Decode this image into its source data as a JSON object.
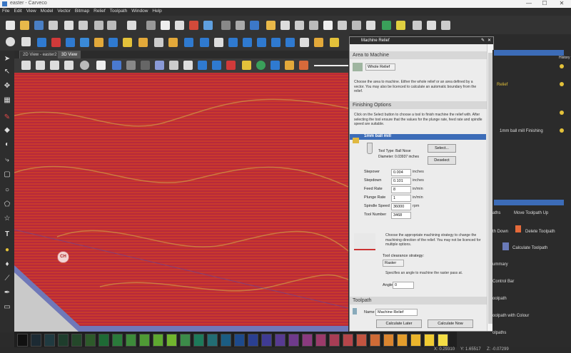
{
  "window": {
    "title": "easter - Carveco",
    "controls": [
      "—",
      "☐",
      "✕"
    ]
  },
  "menu": [
    "File",
    "Edit",
    "View",
    "Model",
    "Vector",
    "Bitmap",
    "Relief",
    "Toolpath",
    "Window",
    "Help"
  ],
  "tabs": [
    {
      "label": "2D View - easter2"
    },
    {
      "label": "3D View"
    }
  ],
  "viewport": {
    "cursor_badge": "CH"
  },
  "dialog": {
    "title": "Machine Relief",
    "area_section": "Area to Machine",
    "area_select": "Whole Relief",
    "area_text": "Choose the area to machine. Either the whole relief or an area defined by a vector. You may also be licenced to calculate an automatic boundary from the relief.",
    "finishing_section": "Finishing Options",
    "finishing_text": "Click on the Select button to choose a tool to finish machine the relief with. After selecting the tool ensure that the values for the plunge rate, feed rate and spindle speed are suitable.",
    "tool_header": "1mm ball mill",
    "tool_type": "Tool Type: Ball Nose",
    "tool_diameter": "Diameter:  0.03937 inches",
    "select_btn": "Select...",
    "deselect_btn": "Deselect",
    "fields": [
      {
        "label": "Stepover",
        "value": "0.004",
        "unit": "inches"
      },
      {
        "label": "Stepdown",
        "value": "0.101",
        "unit": "inches"
      },
      {
        "label": "Feed Rate",
        "value": "8",
        "unit": "in/min"
      },
      {
        "label": "Plunge Rate",
        "value": "1",
        "unit": "in/min"
      },
      {
        "label": "Spindle Speed",
        "value": "36000",
        "unit": "rpm"
      },
      {
        "label": "Tool Number",
        "value": "3468",
        "unit": ""
      }
    ],
    "strategy_text": "Choose the appropriate machining strategy to change the machining direction of the relief. You may not be licenced for multiple options.",
    "clearance_label": "Tool clearance strategy:",
    "clearance_value": "Raster",
    "angle_text": "Specifies an angle to machine the raster pass at.",
    "angle_label": "Angle",
    "angle_value": "0",
    "toolpath_section": "Toolpath",
    "name_label": "Name",
    "name_value": "Machine Relief",
    "calc_later": "Calculate Later",
    "calc_now": "Calculate Now"
  },
  "right_panel": {
    "relief_label": "Relief",
    "toolpath_item": "1mm ball mill Finishing",
    "side_tab": "History",
    "items": [
      "aths",
      "Move Toolpath Up",
      "th Down",
      "Delete Toolpath",
      "Calculate Toolpath",
      "ummary",
      "Control Bar",
      "oolpath",
      "oolpath with Colour",
      "olpaths"
    ]
  },
  "palette": {
    "colors": [
      "#111111",
      "#1c2a33",
      "#203a40",
      "#1e3d2c",
      "#24482a",
      "#2d5a2a",
      "#1e6a35",
      "#2a7a3a",
      "#3d8b3a",
      "#4f9a35",
      "#5ea830",
      "#71b52e",
      "#3c8b49",
      "#1d7a5a",
      "#226d74",
      "#1b5d83",
      "#1d4a8c",
      "#2a3f91",
      "#3f3b94",
      "#573a92",
      "#6f3a8c",
      "#8a3a7f",
      "#9b3a6a",
      "#a83d55",
      "#b6454a",
      "#c25440",
      "#cf6b36",
      "#da852f",
      "#e39d2c",
      "#ebb52c",
      "#f0cb32",
      "#f3dd45"
    ]
  },
  "status": {
    "x": "X: 0.29310",
    "y": "Y: 1.65517",
    "z": "Z: -0.07299"
  }
}
